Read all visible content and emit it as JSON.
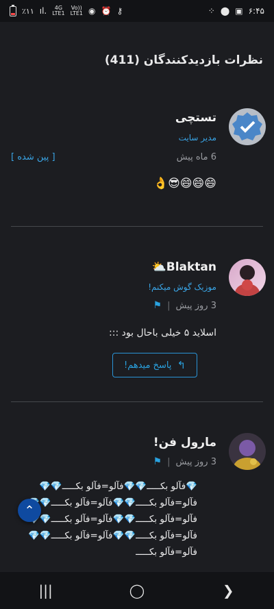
{
  "status": {
    "time": "۶:۴۵",
    "battery": "٪۱۱",
    "network": "4G LTE1",
    "volte": "Vo)) LTE1",
    "icons": [
      "battery-icon",
      "signal-icon",
      "volte-icon",
      "hotspot-icon",
      "alarm-icon",
      "key-icon",
      "grid-icon",
      "location-icon",
      "image-icon"
    ]
  },
  "section": {
    "title": "نظرات بازدیدکنندگان (411)"
  },
  "comments": [
    {
      "name": "تستچی",
      "role": "مدیر سایت",
      "time": "6 ماه پیش",
      "pinned": "[ پین شده ]",
      "text": "😄😄😄😎👌"
    },
    {
      "name": "Blaktan⛅",
      "role": "موزیک گوش میکنم!",
      "time": "3 روز پیش",
      "text": "اسلاید ۵ خیلی باحال بود :::",
      "reply": "پاسخ میدهم!"
    },
    {
      "name": "مارول فن!",
      "time": "3 روز پیش",
      "text": "💎فآلو بکـــــ💎💎فآلو=فآلو بکـــــ💎💎فآلو=فآلو بکـــــ💎💎فآلو=فآلو بکـــــ💎💎فآلو=فآلو بکـــــ💎💎فآلو=فآلو بکـــــ💎💎فآلو=فآلو بکـــــ💎💎فآلو=فآلو بکـــــ💎💎فآلو=فآلو بکـــــ"
    }
  ],
  "nav": {
    "recents": "|||",
    "home": "◯",
    "back": "❯"
  },
  "colors": {
    "accent": "#2aa2e0",
    "background": "#1c1d21"
  }
}
